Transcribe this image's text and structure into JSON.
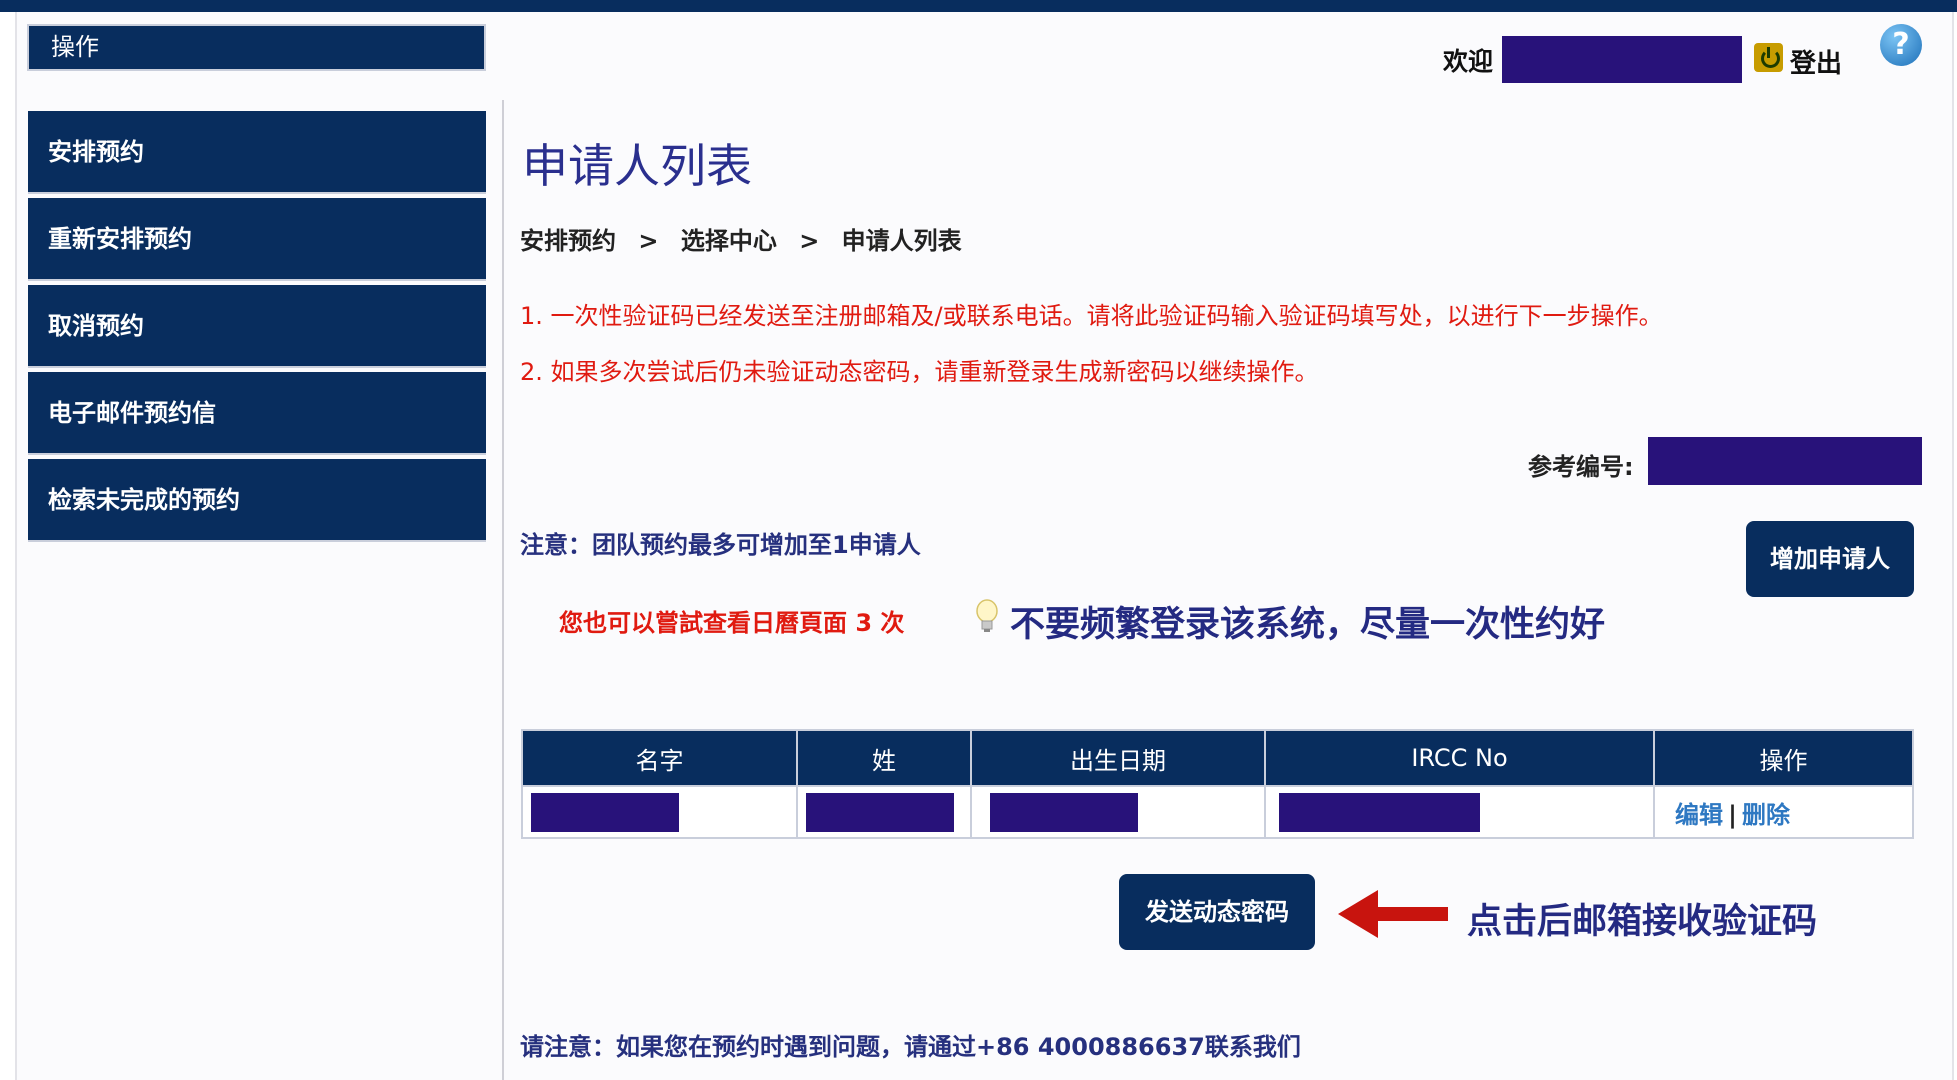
{
  "sidebar": {
    "header": "操作",
    "items": [
      {
        "label": "安排预约"
      },
      {
        "label": "重新安排预约"
      },
      {
        "label": "取消预约"
      },
      {
        "label": "电子邮件预约信"
      },
      {
        "label": "检索未完成的预约"
      }
    ]
  },
  "header": {
    "welcome": "欢迎",
    "logout": "登出",
    "help": "?"
  },
  "page": {
    "title": "申请人列表",
    "breadcrumb": [
      "安排预约",
      ">",
      "选择中心",
      ">",
      "申请人列表"
    ],
    "notices": [
      "1. 一次性验证码已经发送至注册邮箱及/或联系电话。请将此验证码输入验证码填写处，以进行下一步操作。",
      "2. 如果多次尝试后仍未验证动态密码，请重新登录生成新密码以继续操作。"
    ],
    "reference_label": "参考编号:",
    "group_note": "注意：团队预约最多可增加至1申请人",
    "add_applicant_button": "增加申请人",
    "calendar_tries": "您也可以嘗試查看日曆頁面 3 次",
    "tip": "不要频繁登录该系统，尽量一次性约好"
  },
  "table": {
    "headers": [
      "名字",
      "姓",
      "出生日期",
      "IRCC No",
      "操作"
    ],
    "rows": [
      {
        "edit": "编辑",
        "separator": "|",
        "delete": "删除"
      }
    ]
  },
  "actions": {
    "send_code_button": "发送动态密码",
    "annotation": "点击后邮箱接收验证码"
  },
  "footer": {
    "note": "请注意：如果您在预约时遇到问题，请通过+86 4000886637联系我们"
  },
  "colors": {
    "navy": "#082d5e",
    "redaction": "#28127a",
    "notice_red": "#e01a10",
    "title_blue": "#2a2f8e",
    "link_blue": "#2e78c2"
  }
}
